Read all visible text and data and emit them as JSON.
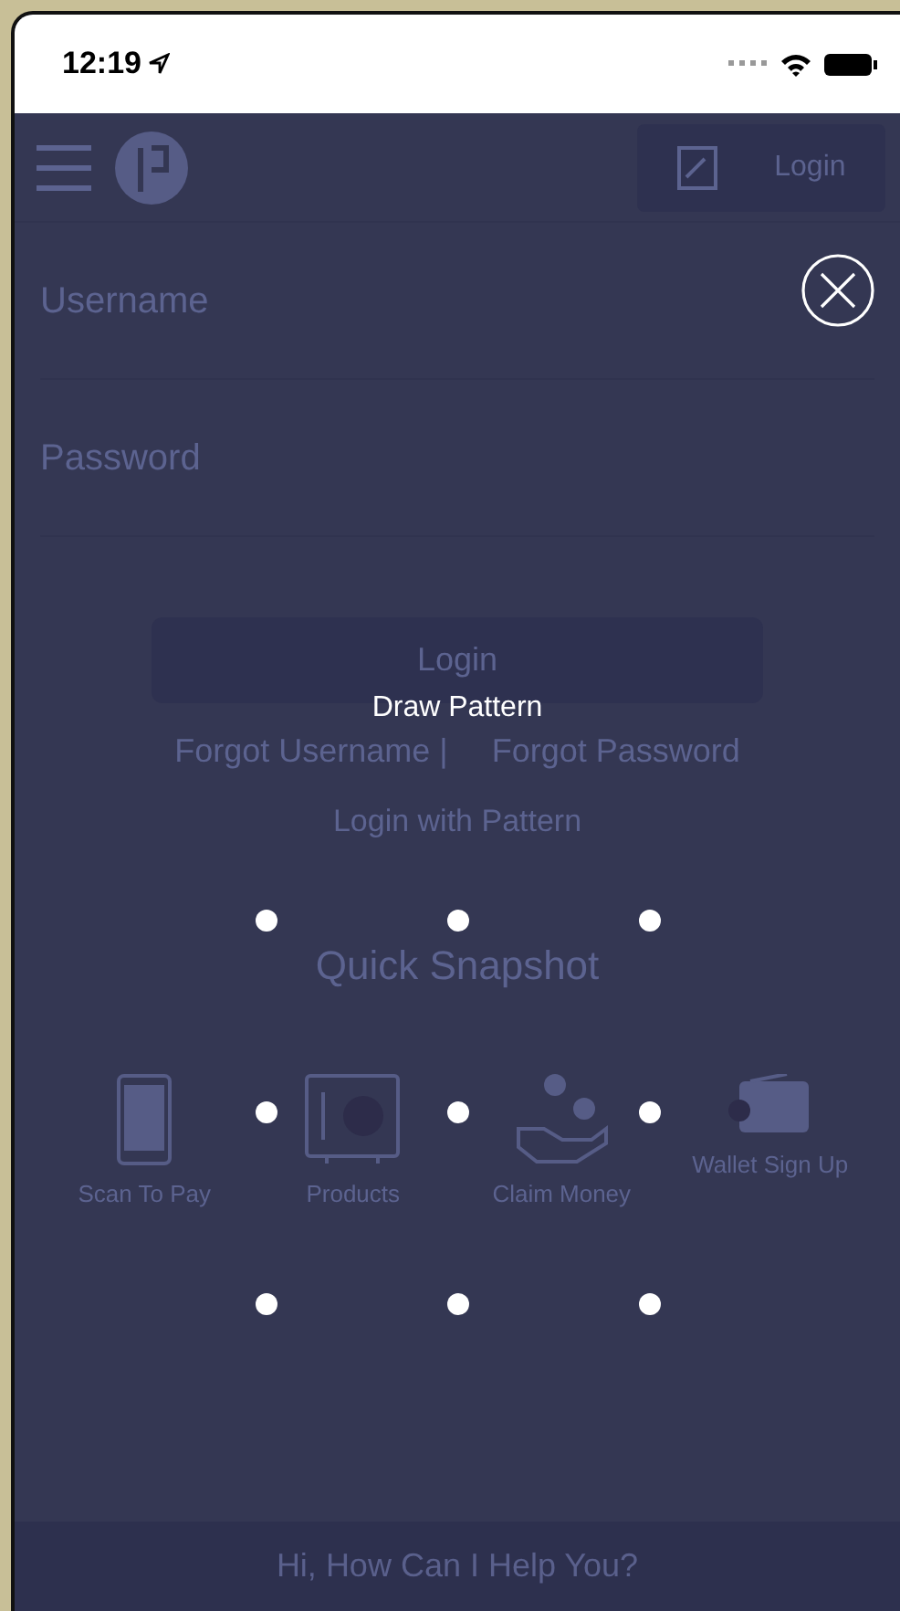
{
  "status_bar": {
    "time": "12:19"
  },
  "header": {
    "login_button": "Login"
  },
  "form": {
    "username": {
      "placeholder": "Username"
    },
    "password": {
      "placeholder": "Password"
    },
    "login_button": "Login",
    "forgot_username": "Forgot Username |",
    "forgot_password": "Forgot Password",
    "pattern_link": "Login with Pattern"
  },
  "quick_snapshot": {
    "title": "Quick Snapshot",
    "items": [
      {
        "kind": "phone",
        "label": "Scan To Pay"
      },
      {
        "kind": "safe",
        "label": "Products"
      },
      {
        "kind": "hand",
        "label": "Claim Money"
      },
      {
        "kind": "wallet",
        "label": "Wallet Sign Up"
      }
    ]
  },
  "chat_bar": {
    "text": "Hi, How Can I Help You?"
  },
  "pattern_overlay": {
    "title": "Draw Pattern"
  }
}
